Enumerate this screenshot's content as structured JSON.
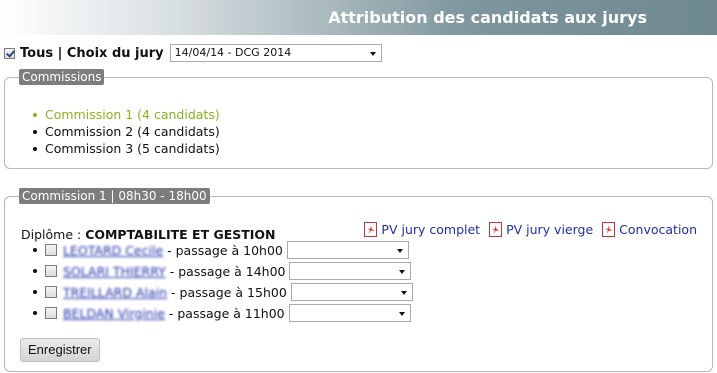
{
  "header": {
    "title": "Attribution des candidats aux jurys"
  },
  "toolbar": {
    "checkbox_checked": true,
    "label": "Tous | Choix du jury",
    "jury_select": "14/04/14 - DCG 2014"
  },
  "commissions_panel": {
    "legend": "Commissions",
    "items": [
      {
        "label": "Commission 1 (4 candidats)",
        "active": true
      },
      {
        "label": "Commission 2 (4 candidats)",
        "active": false
      },
      {
        "label": "Commission 3 (5 candidats)",
        "active": false
      }
    ]
  },
  "commission_panel": {
    "legend": "Commission 1 | 08h30 - 18h00",
    "diplome_label": "Diplôme : ",
    "diplome_value": "COMPTABILITE ET GESTION",
    "links": [
      {
        "label": "PV jury complet",
        "icon": "pdf-icon"
      },
      {
        "label": "PV jury vierge",
        "icon": "pdf-icon"
      },
      {
        "label": "Convocation",
        "icon": "pdf-icon"
      }
    ],
    "candidates": [
      {
        "name": "LEOTARD Cecile",
        "passage": "- passage à 10h00",
        "select": ""
      },
      {
        "name": "SOLARI THIERRY",
        "passage": "- passage à 14h00",
        "select": ""
      },
      {
        "name": "TREILLARD Alain",
        "passage": "- passage à 15h00",
        "select": ""
      },
      {
        "name": "BELDAN Virginie",
        "passage": "- passage à 11h00",
        "select": ""
      }
    ],
    "save_button": "Enregistrer"
  },
  "colors": {
    "active_commission": "#89b21e",
    "link": "#1f2fa5",
    "legend_bg": "#7d7d7d"
  }
}
